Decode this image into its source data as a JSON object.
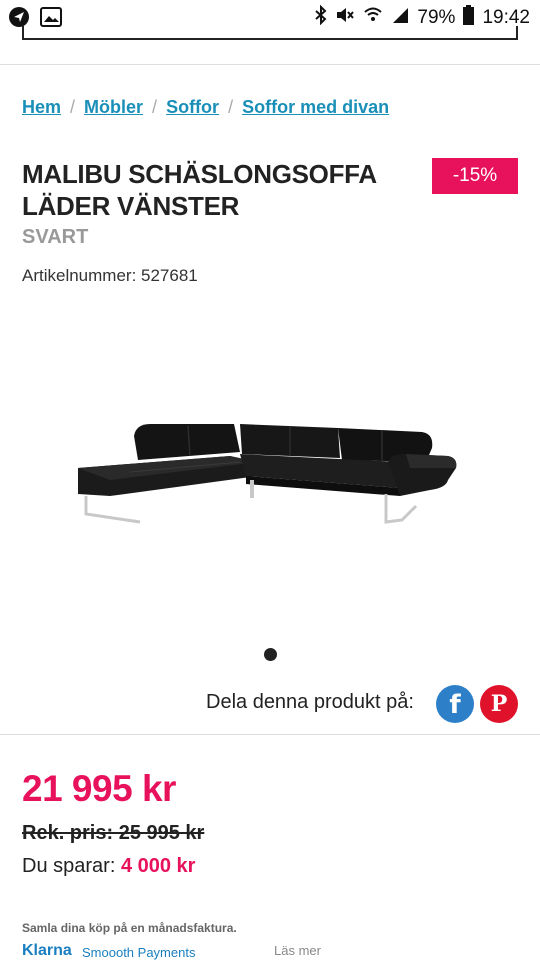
{
  "status_bar": {
    "battery": "79%",
    "time": "19:42"
  },
  "breadcrumb": [
    "Hem",
    "Möbler",
    "Soffor",
    "Soffor med divan"
  ],
  "product": {
    "title_line1": "MALIBU SCHÄSLONGSOFFA",
    "title_line2": "LÄDER VÄNSTER",
    "color": "SVART",
    "article_number": "Artikelnummer: 527681",
    "discount_badge": "-15%"
  },
  "share": {
    "label": "Dela denna produkt på:",
    "facebook": "f",
    "pinterest": "P"
  },
  "pricing": {
    "price": "21 995 kr",
    "regular_price": "Rek. pris: 25 995 kr",
    "save_label": "Du sparar:",
    "save_amount": "4 000 kr"
  },
  "klarna": {
    "note": "Samla dina köp på en månadsfaktura.",
    "logo": "Klarna",
    "tagline": "Smoooth Payments",
    "read_more": "Läs mer"
  },
  "colors": {
    "accent_pink": "#e8125c",
    "link_blue": "#1a8fb8",
    "facebook_blue": "#2d7fc8",
    "pinterest_red": "#e0112b"
  }
}
